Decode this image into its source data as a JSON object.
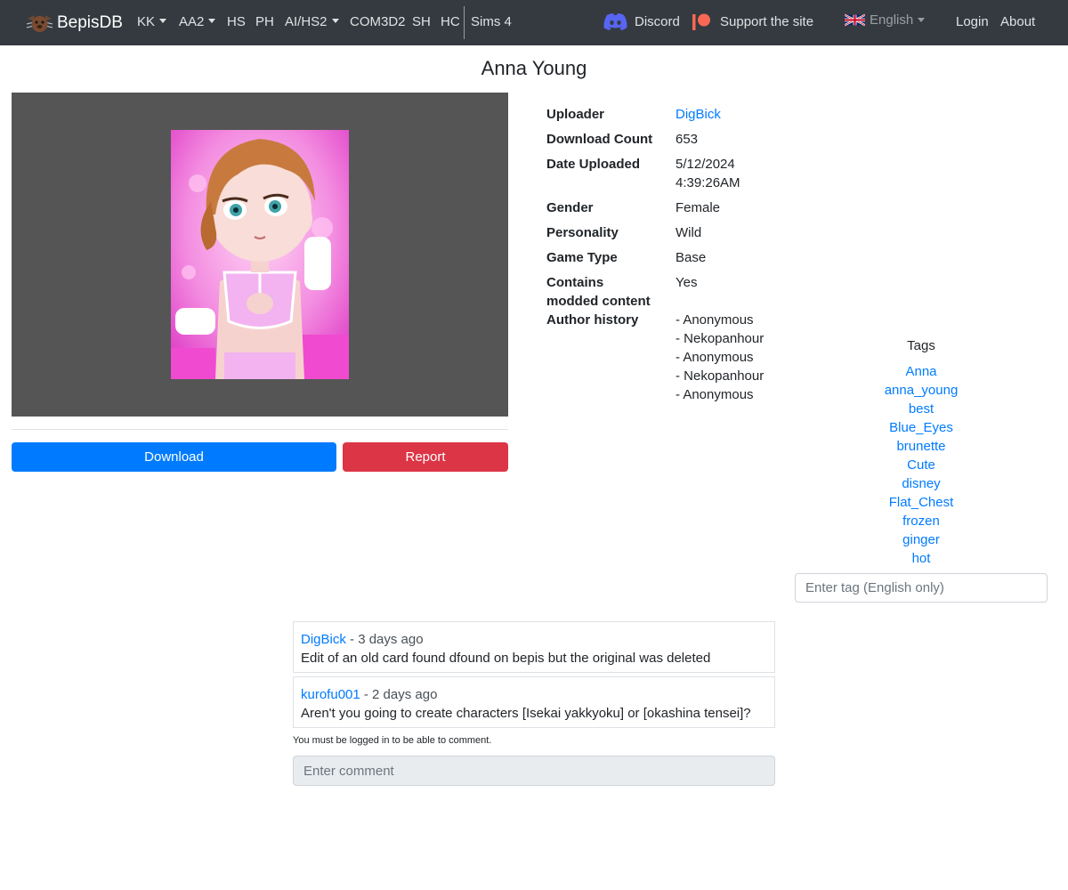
{
  "navbar": {
    "brand": "BepisDB",
    "items": [
      {
        "label": "KK",
        "dropdown": true
      },
      {
        "label": "AA2",
        "dropdown": true
      },
      {
        "label": "HS",
        "dropdown": false
      },
      {
        "label": "PH",
        "dropdown": false
      },
      {
        "label": "AI/HS2",
        "dropdown": true
      },
      {
        "label": "COM3D2",
        "dropdown": false
      },
      {
        "label": "SH",
        "dropdown": false
      },
      {
        "label": "HC",
        "dropdown": false
      },
      {
        "label": "Sims 4",
        "dropdown": false
      }
    ],
    "discord": "Discord",
    "support": "Support the site",
    "language": "English",
    "login": "Login",
    "about": "About"
  },
  "card": {
    "title": "Anna Young",
    "info": [
      {
        "label": "Uploader",
        "value": "DigBick",
        "link": true
      },
      {
        "label": "Download Count",
        "value": "653"
      },
      {
        "label": "Date Uploaded",
        "value_lines": [
          "5/12/2024",
          "4:39:26AM"
        ]
      },
      {
        "label": "Gender",
        "value": "Female"
      },
      {
        "label": "Personality",
        "value": "Wild"
      },
      {
        "label": "Game Type",
        "value": "Base"
      },
      {
        "label_lines": [
          "Contains",
          "modded content"
        ],
        "value": "Yes"
      },
      {
        "label": "Author history",
        "value_lines": [
          "- Anonymous",
          "- Nekopanhour",
          "- Anonymous",
          "- Nekopanhour",
          "- Anonymous"
        ]
      }
    ],
    "download_label": "Download",
    "report_label": "Report"
  },
  "tags": {
    "title": "Tags",
    "items": [
      "Anna",
      "anna_young",
      "best",
      "Blue_Eyes",
      "brunette",
      "Cute",
      "disney",
      "Flat_Chest",
      "frozen",
      "ginger",
      "hot"
    ],
    "input_placeholder": "Enter tag (English only)"
  },
  "comments": {
    "items": [
      {
        "user": "DigBick",
        "time": " - 3 days ago",
        "text": "Edit of an old card found dfound on bepis but the original was deleted"
      },
      {
        "user": "kurofu001",
        "time": " - 2 days ago",
        "text": "Aren't you going to create characters [Isekai yakkyoku] or [okashina tensei]?"
      }
    ],
    "login_note": "You must be logged in to be able to comment.",
    "input_placeholder": "Enter comment"
  },
  "colors": {
    "navbar": "#343a40",
    "primary": "#007bff",
    "danger": "#dc3545",
    "discord": "#5865f2",
    "patreon": "#f96854"
  }
}
